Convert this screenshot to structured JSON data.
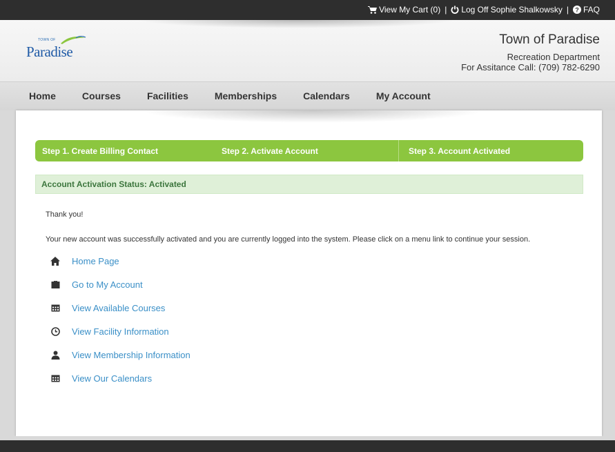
{
  "topbar": {
    "cart_label": "View My Cart (0)",
    "separator": "|",
    "logoff_label": "Log Off Sophie Shalkowsky",
    "faq_label": "FAQ"
  },
  "header": {
    "logo_small": "TOWN OF",
    "logo_text": "Paradise",
    "org_name": "Town of Paradise",
    "department": "Recreation Department",
    "phone": "For Assitance Call: (709) 782-6290"
  },
  "nav": {
    "items": [
      "Home",
      "Courses",
      "Facilities",
      "Memberships",
      "Calendars",
      "My Account"
    ]
  },
  "steps": {
    "step1": "Step 1. Create Billing Contact",
    "step2": "Step 2. Activate Account",
    "step3": "Step 3. Account Activated"
  },
  "status": {
    "label": "Account Activation Status:",
    "value": "Activated"
  },
  "content": {
    "thanks": "Thank you!",
    "message": "Your new account was successfully activated and you are currently logged into the system. Please click on a menu link to continue your session."
  },
  "links": [
    {
      "label": "Home Page",
      "icon": "home-icon"
    },
    {
      "label": "Go to My Account",
      "icon": "briefcase-icon"
    },
    {
      "label": "View Available Courses",
      "icon": "calendar-icon"
    },
    {
      "label": "View Facility Information",
      "icon": "clock-icon"
    },
    {
      "label": "View Membership Information",
      "icon": "user-icon"
    },
    {
      "label": "View Our Calendars",
      "icon": "calendar-icon"
    }
  ],
  "colors": {
    "accent_green": "#8cc63f",
    "status_bg": "#dff0d8",
    "status_text": "#3c763d",
    "link_blue": "#3a8fc7",
    "topbar_bg": "#2e2e2e"
  }
}
